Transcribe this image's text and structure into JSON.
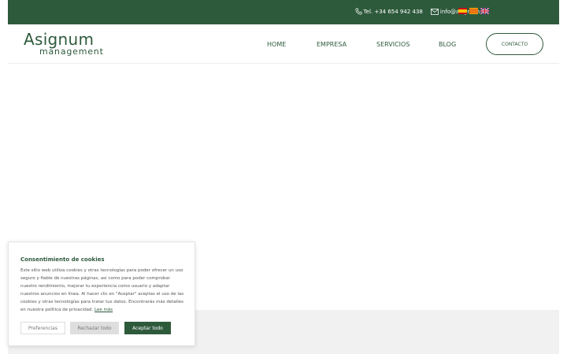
{
  "topbar": {
    "phone": "Tel. +34 654 942 438",
    "email": "info@asignum.eu",
    "flags": [
      "spanish-flag",
      "catalan-flag",
      "uk-flag"
    ]
  },
  "header": {
    "logo_main": "Asignum",
    "logo_sub": "management",
    "nav": [
      "HOME",
      "EMPRESA",
      "SERVICIOS",
      "BLOG"
    ],
    "active_nav": "HOME",
    "contact_button": "CONTACTO"
  },
  "cookie": {
    "title": "Consentimiento de cookies",
    "text": "Este sitio web utiliza cookies y otras tecnologías para poder ofrecer un uso seguro y fiable de nuestras páginas, así como para poder comprobar nuestro rendimiento, mejorar tu experiencia como usuario y adaptar nuestros anuncios en línea. Al hacer clic en \"Aceptar\" aceptas el uso de las cookies y otras tecnologías para tratar tus datos. Encontrarás más detalles en nuestra política de privacidad.",
    "link": "Lee más",
    "preferences": "Preferencias",
    "reject": "Rechazar todo",
    "accept": "Aceptar todo"
  },
  "colors": {
    "brand": "#2e5a3c",
    "band": "#f1f1f1"
  }
}
